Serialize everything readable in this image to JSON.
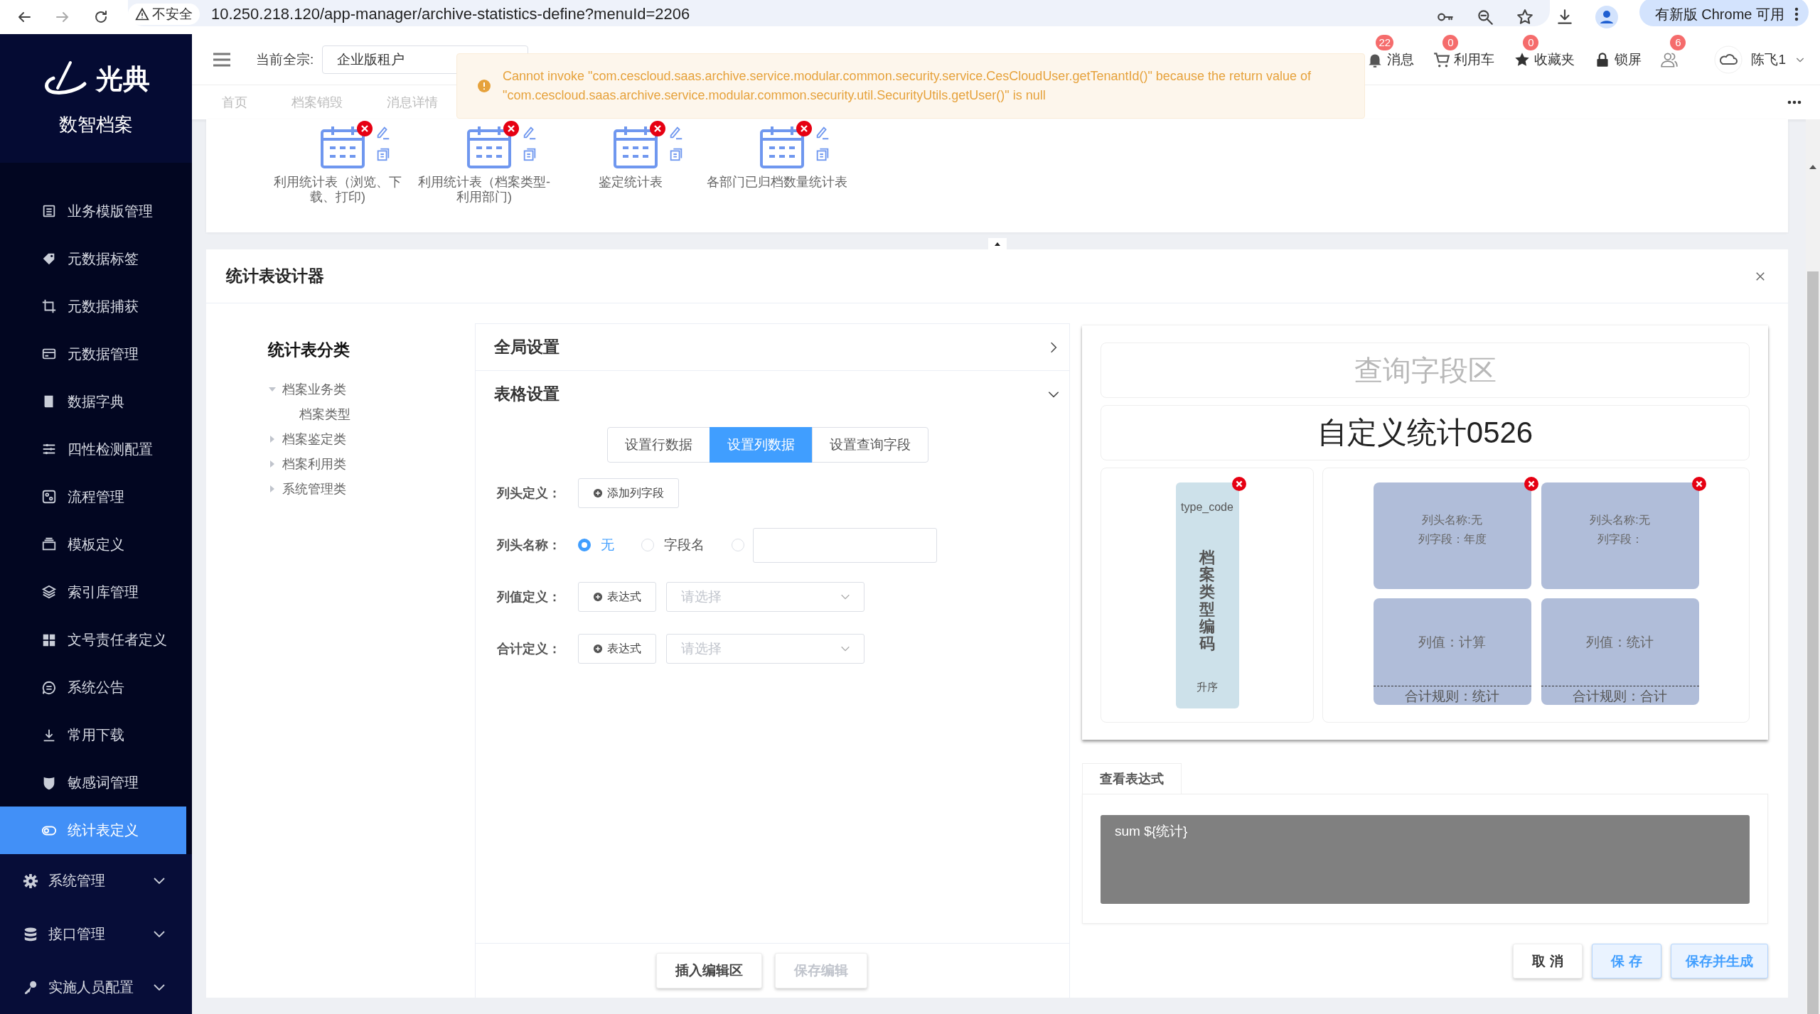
{
  "browser": {
    "security": "不安全",
    "url": "10.250.218.120/app-manager/archive-statistics-define?menuId=2206",
    "update": "有新版 Chrome 可用"
  },
  "sidebar": {
    "logo": "光典",
    "app_name": "数智档案",
    "items": [
      {
        "kind": "link",
        "label": "业务模版管理",
        "selected": false
      },
      {
        "kind": "link",
        "label": "元数据标签",
        "selected": false
      },
      {
        "kind": "link",
        "label": "元数据捕获",
        "selected": false
      },
      {
        "kind": "link",
        "label": "元数据管理",
        "selected": false
      },
      {
        "kind": "link",
        "label": "数据字典",
        "selected": false
      },
      {
        "kind": "link",
        "label": "四性检测配置",
        "selected": false
      },
      {
        "kind": "link",
        "label": "流程管理",
        "selected": false
      },
      {
        "kind": "link",
        "label": "模板定义",
        "selected": false
      },
      {
        "kind": "link",
        "label": "索引库管理",
        "selected": false
      },
      {
        "kind": "link",
        "label": "文号责任者定义",
        "selected": false
      },
      {
        "kind": "link",
        "label": "系统公告",
        "selected": false
      },
      {
        "kind": "link",
        "label": "常用下载",
        "selected": false
      },
      {
        "kind": "link",
        "label": "敏感词管理",
        "selected": false
      },
      {
        "kind": "link",
        "label": "统计表定义",
        "selected": true
      },
      {
        "kind": "group",
        "label": "系统管理",
        "expanded": false
      },
      {
        "kind": "group",
        "label": "接口管理",
        "expanded": false
      },
      {
        "kind": "group",
        "label": "实施人员配置",
        "expanded": false
      }
    ]
  },
  "header": {
    "fonds_label": "当前全宗:",
    "fonds_value": "企业版租户",
    "tools": [
      {
        "kind": "bell",
        "label": "消息",
        "count": "22"
      },
      {
        "kind": "cart",
        "label": "利用车",
        "count": "0"
      },
      {
        "kind": "star",
        "label": "收藏夹",
        "count": "0"
      },
      {
        "kind": "lock",
        "label": "锁屏"
      },
      {
        "kind": "users",
        "count": "6"
      }
    ],
    "user": "陈飞1"
  },
  "tabs": [
    {
      "label": "首页"
    },
    {
      "label": "档案销毁"
    },
    {
      "label": "消息详情"
    }
  ],
  "alert": {
    "message": "Cannot invoke \"com.cescloud.saas.archive.service.modular.common.security.service.CesCloudUser.getTenantId()\" because the return value of \"com.cescloud.saas.archive.service.modular.common.security.util.SecurityUtils.getUser()\" is null"
  },
  "templates": [
    {
      "title": "利用统计表（浏览、下载、打印)"
    },
    {
      "title": "利用统计表（档案类型-利用部门)"
    },
    {
      "title": "鉴定统计表"
    },
    {
      "title": "各部门已归档数量统计表"
    }
  ],
  "designer": {
    "title": "统计表设计器",
    "category_title": "统计表分类",
    "tree": [
      {
        "label": "档案业务类",
        "expanded": true,
        "children": [
          {
            "label": "档案类型"
          }
        ]
      },
      {
        "label": "档案鉴定类",
        "expanded": false
      },
      {
        "label": "档案利用类",
        "expanded": false
      },
      {
        "label": "系统管理类",
        "expanded": false
      }
    ],
    "panels": [
      {
        "title": "全局设置",
        "expanded": false
      },
      {
        "title": "表格设置",
        "expanded": true
      }
    ],
    "segments": [
      {
        "label": "设置行数据",
        "selected": false
      },
      {
        "label": "设置列数据",
        "selected": true
      },
      {
        "label": "设置查询字段",
        "selected": false
      }
    ],
    "form": {
      "header_def_label": "列头定义：",
      "add_field_button": "添加列字段",
      "header_name_label": "列头名称：",
      "header_name_options": [
        {
          "kind": "text",
          "label": "无",
          "selected": true
        },
        {
          "kind": "text",
          "label": "字段名",
          "selected": false
        },
        {
          "kind": "input",
          "selected": false
        }
      ],
      "value_def_label": "列值定义：",
      "value_expr_button": "表达式",
      "value_select_placeholder": "请选择",
      "total_def_label": "合计定义：",
      "total_expr_button": "表达式",
      "total_select_placeholder": "请选择"
    },
    "footer_buttons": [
      {
        "label": "插入编辑区",
        "disabled": false
      },
      {
        "label": "保存编辑",
        "disabled": true
      }
    ],
    "preview": {
      "query_area": "查询字段区",
      "title": "自定义统计0526",
      "row_field": {
        "field": "type_code",
        "name": "档案类型编码",
        "sort": "升序"
      },
      "columns": [
        {
          "header": "列头名称:无",
          "field": "列字段：年度",
          "value": "列值：计算",
          "total": "合计规则：统计"
        },
        {
          "header": "列头名称:无",
          "field": "列字段：",
          "value": "列值：统计",
          "total": "合计规则：合计"
        }
      ]
    },
    "expression_tab": "查看表达式",
    "expression": "sum ${统计}",
    "actions": [
      {
        "kind": "default",
        "label": "取 消"
      },
      {
        "kind": "primary",
        "label": "保 存"
      },
      {
        "kind": "primary",
        "label": "保存并生成"
      }
    ]
  }
}
